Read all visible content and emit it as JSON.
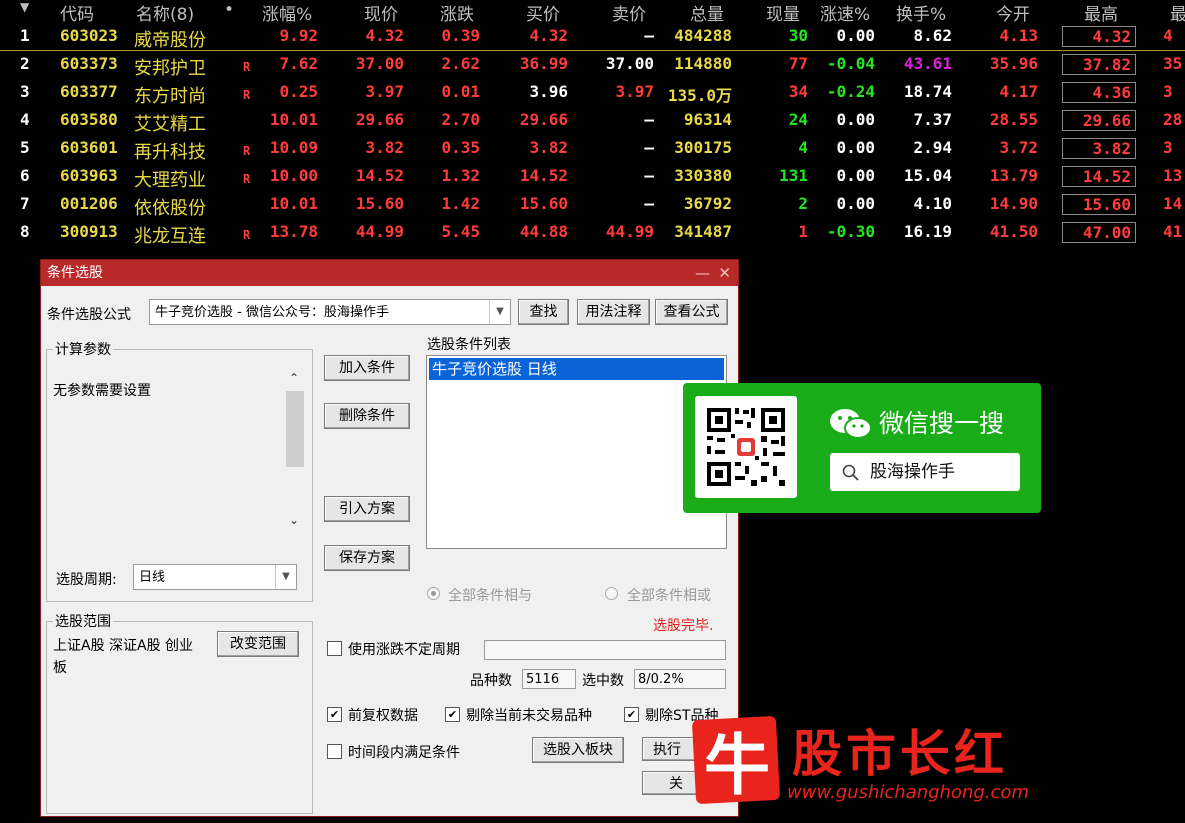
{
  "quote_table": {
    "headers": [
      "▼",
      "代码",
      "名称(8)",
      "•",
      "涨幅%",
      "现价",
      "涨跌",
      "买价",
      "卖价",
      "总量",
      "现量",
      "涨速%",
      "换手%",
      "今开",
      "最高",
      "最"
    ],
    "rows": [
      {
        "idx": "1",
        "code": "603023",
        "name": "威帝股份",
        "flag": "",
        "pct": "9.92",
        "price": "4.32",
        "chg": "0.39",
        "bid": "4.32",
        "ask": "—",
        "vol": "484288",
        "cur": "30",
        "speed": "0.00",
        "turn": "8.62",
        "open": "4.13",
        "high": "4.32",
        "last": "4"
      },
      {
        "idx": "2",
        "code": "603373",
        "name": "安邦护卫",
        "flag": "R",
        "pct": "7.62",
        "price": "37.00",
        "chg": "2.62",
        "bid": "36.99",
        "ask": "37.00",
        "vol": "114880",
        "cur": "77",
        "speed": "-0.04",
        "turn": "43.61",
        "open": "35.96",
        "high": "37.82",
        "last": "35"
      },
      {
        "idx": "3",
        "code": "603377",
        "name": "东方时尚",
        "flag": "R",
        "pct": "0.25",
        "price": "3.97",
        "chg": "0.01",
        "bid": "3.96",
        "ask": "3.97",
        "vol": "135.0万",
        "cur": "34",
        "speed": "-0.24",
        "turn": "18.74",
        "open": "4.17",
        "high": "4.36",
        "last": "3"
      },
      {
        "idx": "4",
        "code": "603580",
        "name": "艾艾精工",
        "flag": "",
        "pct": "10.01",
        "price": "29.66",
        "chg": "2.70",
        "bid": "29.66",
        "ask": "—",
        "vol": "96314",
        "cur": "24",
        "speed": "0.00",
        "turn": "7.37",
        "open": "28.55",
        "high": "29.66",
        "last": "28"
      },
      {
        "idx": "5",
        "code": "603601",
        "name": "再升科技",
        "flag": "R",
        "pct": "10.09",
        "price": "3.82",
        "chg": "0.35",
        "bid": "3.82",
        "ask": "—",
        "vol": "300175",
        "cur": "4",
        "speed": "0.00",
        "turn": "2.94",
        "open": "3.72",
        "high": "3.82",
        "last": "3"
      },
      {
        "idx": "6",
        "code": "603963",
        "name": "大理药业",
        "flag": "R",
        "pct": "10.00",
        "price": "14.52",
        "chg": "1.32",
        "bid": "14.52",
        "ask": "—",
        "vol": "330380",
        "cur": "131",
        "speed": "0.00",
        "turn": "15.04",
        "open": "13.79",
        "high": "14.52",
        "last": "13"
      },
      {
        "idx": "7",
        "code": "001206",
        "name": "依依股份",
        "flag": "",
        "pct": "10.01",
        "price": "15.60",
        "chg": "1.42",
        "bid": "15.60",
        "ask": "—",
        "vol": "36792",
        "cur": "2",
        "speed": "0.00",
        "turn": "4.10",
        "open": "14.90",
        "high": "15.60",
        "last": "14"
      },
      {
        "idx": "8",
        "code": "300913",
        "name": "兆龙互连",
        "flag": "R",
        "pct": "13.78",
        "price": "44.99",
        "chg": "5.45",
        "bid": "44.88",
        "ask": "44.99",
        "vol": "341487",
        "cur": "1",
        "speed": "-0.30",
        "turn": "16.19",
        "open": "41.50",
        "high": "47.00",
        "last": "41"
      }
    ]
  },
  "dialog": {
    "title": "条件选股",
    "win_min": "—",
    "win_close": "✕",
    "formula_label": "条件选股公式",
    "formula_value": "牛子竞价选股 - 微信公众号：股海操作手",
    "find_button": "查找",
    "usage_button": "用法注释",
    "view_button": "查看公式",
    "params_group": "计算参数",
    "params_text": "无参数需要设置",
    "period_label": "选股周期:",
    "period_value": "日线",
    "add_condition": "加入条件",
    "delete_condition": "删除条件",
    "import_plan": "引入方案",
    "save_plan": "保存方案",
    "conditions_label": "选股条件列表",
    "conditions": [
      "牛子竞价选股  日线"
    ],
    "radio_and": "全部条件相与",
    "radio_or": "全部条件相或",
    "status": "选股完毕.",
    "range_group": "选股范围",
    "range_text": "上证A股 深证A股 创业板",
    "change_range": "改变范围",
    "use_period_label": "使用涨跌不定周期",
    "count_label": "品种数",
    "count_value": "5116",
    "selected_label": "选中数",
    "selected_value": "8/0.2%",
    "cb_forward": "前复权数据",
    "cb_exclude_nontrade": "剔除当前未交易品种",
    "cb_exclude_st": "剔除ST品种",
    "cb_time_range": "时间段内满足条件",
    "to_block_button": "选股入板块",
    "execute_button": "执行",
    "close_button": "关"
  },
  "wechat_card": {
    "title": "微信搜一搜",
    "search_text": "股海操作手"
  },
  "watermark": {
    "char": "牛",
    "name": "股市长红",
    "url": "www.gushichanghong.com"
  }
}
